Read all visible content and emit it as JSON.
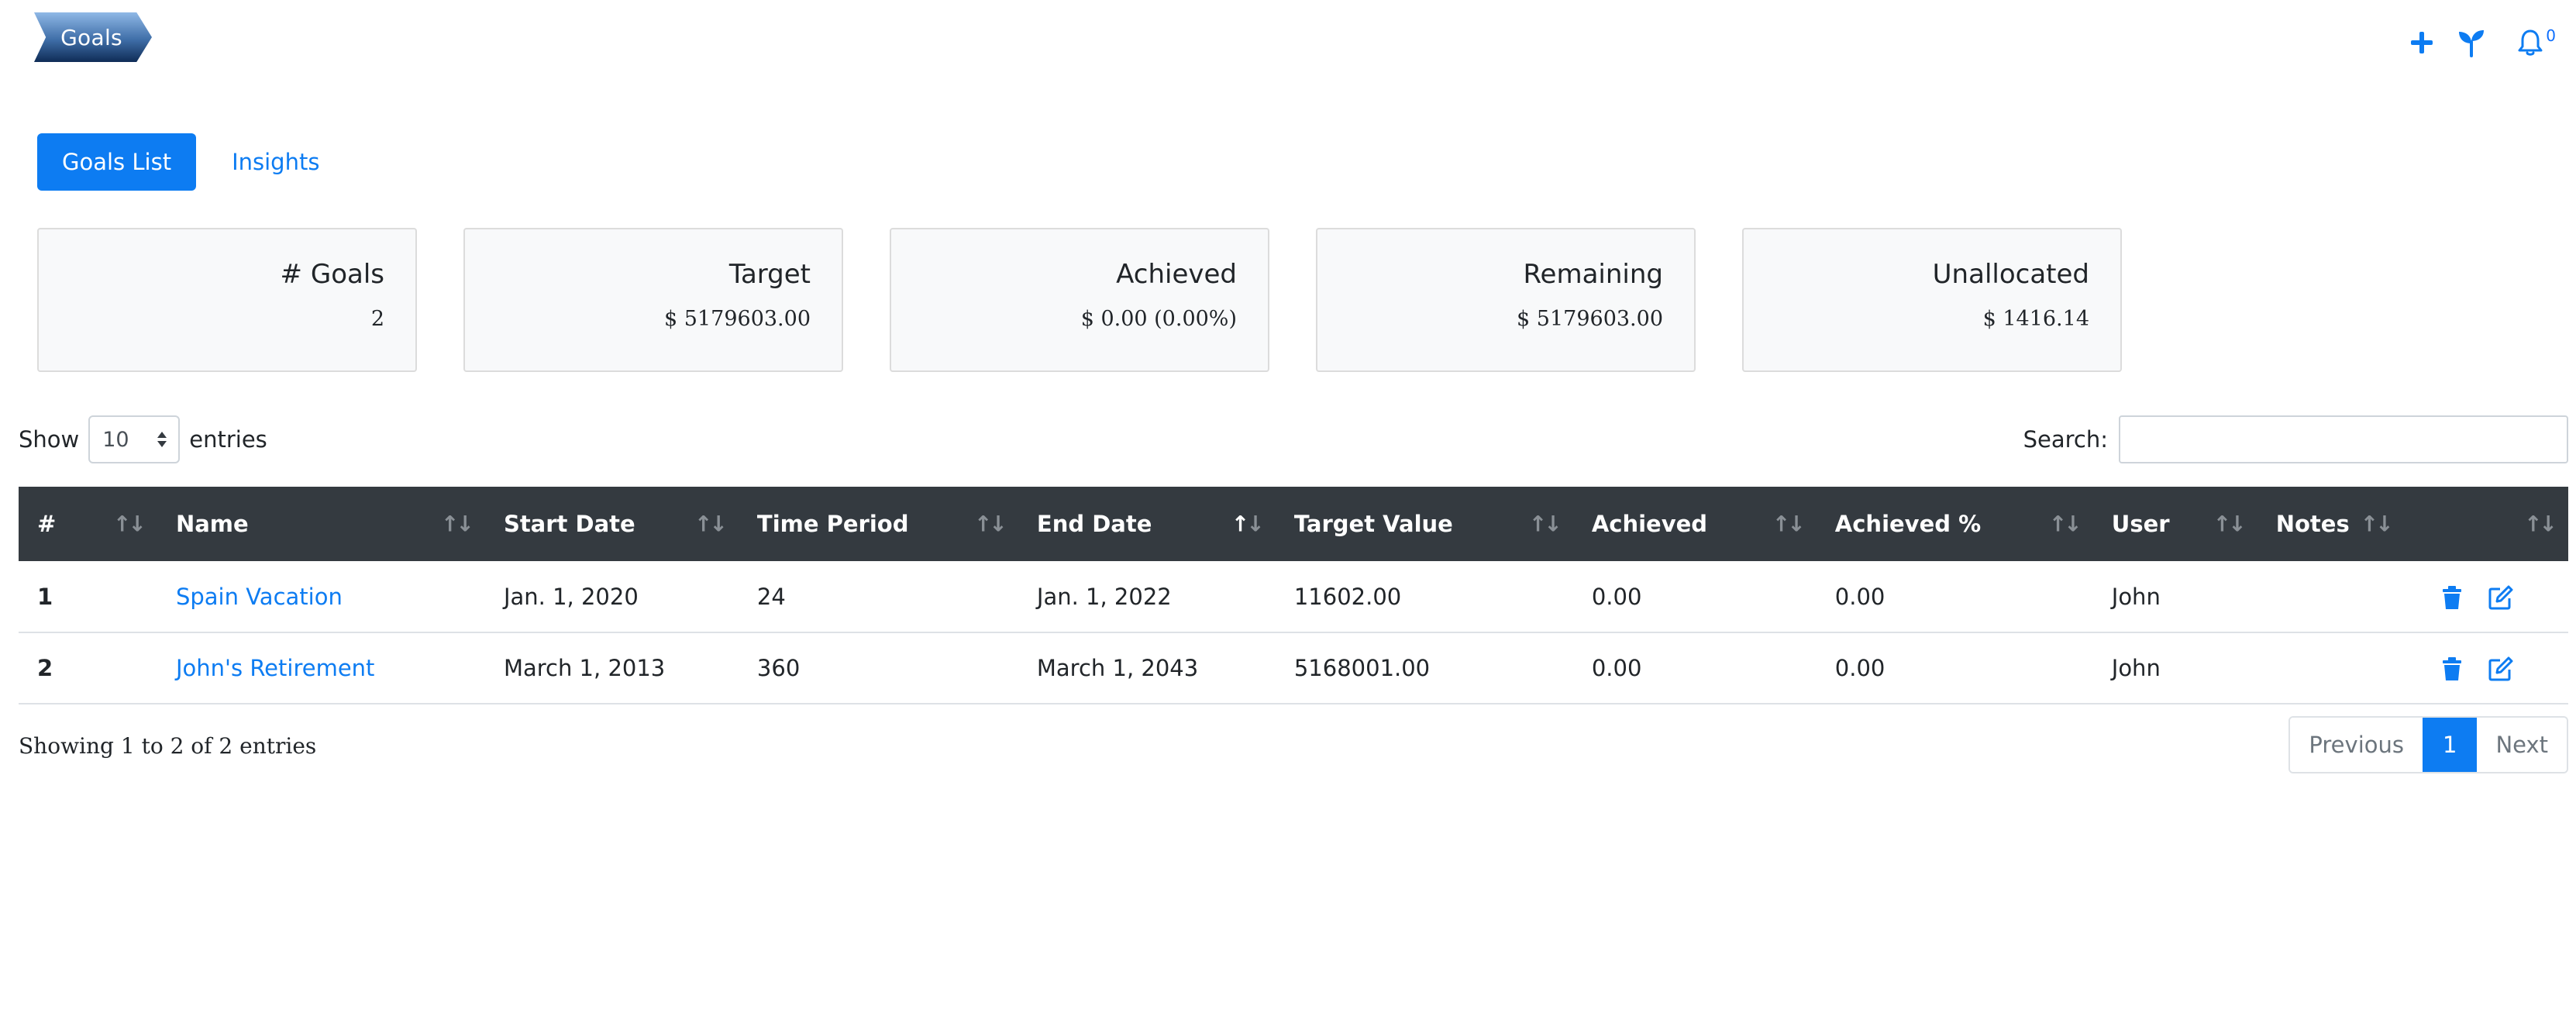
{
  "header": {
    "title": "Goals",
    "notification_count": "0",
    "icons": [
      "plus-icon",
      "sprout-icon",
      "bell-icon"
    ],
    "accent_color": "#0d7cf2"
  },
  "tabs": [
    {
      "label": "Goals List",
      "active": true
    },
    {
      "label": "Insights",
      "active": false
    }
  ],
  "stats": [
    {
      "title": "# Goals",
      "value": "2"
    },
    {
      "title": "Target",
      "value": "$ 5179603.00"
    },
    {
      "title": "Achieved",
      "value": "$ 0.00 (0.00%)"
    },
    {
      "title": "Remaining",
      "value": "$ 5179603.00"
    },
    {
      "title": "Unallocated",
      "value": "$ 1416.14"
    }
  ],
  "table_controls": {
    "show_label": "Show",
    "entries_label": "entries",
    "page_length": "10",
    "search_label": "Search:",
    "search_value": ""
  },
  "table": {
    "columns": [
      "#",
      "Name",
      "Start Date",
      "Time Period",
      "End Date",
      "Target Value",
      "Achieved",
      "Achieved %",
      "User",
      "Notes",
      ""
    ],
    "sorted_column": "End Date",
    "rows": [
      {
        "index": "1",
        "name": "Spain Vacation",
        "start_date": "Jan. 1, 2020",
        "time_period": "24",
        "end_date": "Jan. 1, 2022",
        "target_value": "11602.00",
        "achieved": "0.00",
        "achieved_pct": "0.00",
        "user": "John",
        "notes": ""
      },
      {
        "index": "2",
        "name": "John's Retirement",
        "start_date": "March 1, 2013",
        "time_period": "360",
        "end_date": "March 1, 2043",
        "target_value": "5168001.00",
        "achieved": "0.00",
        "achieved_pct": "0.00",
        "user": "John",
        "notes": ""
      }
    ],
    "row_actions": [
      "trash-icon",
      "edit-icon"
    ]
  },
  "footer": {
    "info": "Showing 1 to 2 of 2 entries",
    "pagination": {
      "previous": "Previous",
      "current": "1",
      "next": "Next"
    }
  }
}
